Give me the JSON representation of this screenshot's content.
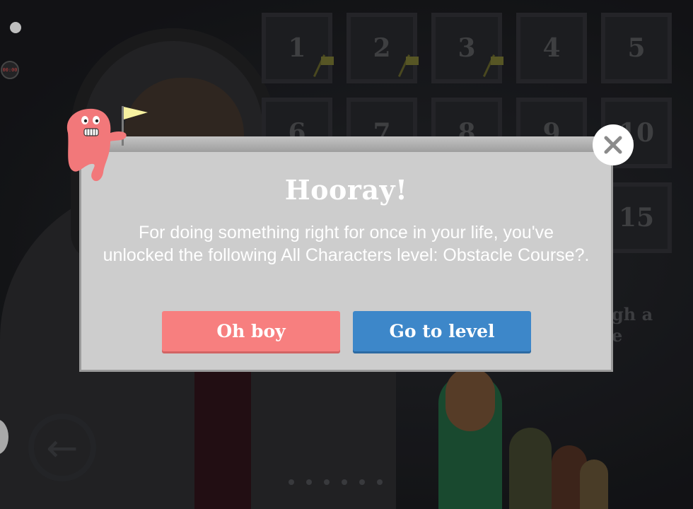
{
  "background": {
    "level_numbers": [
      "1",
      "2",
      "3",
      "4",
      "5",
      "6",
      "7",
      "8",
      "9",
      "10",
      "15"
    ],
    "side_text_line1": "gh a",
    "side_text_line2": "e",
    "timer": "00:00",
    "back_icon": "arrow-left-icon"
  },
  "dialog": {
    "title": "Hooray!",
    "message": "For doing something right for once in your life, you've unlocked the following All Characters level: Obstacle Course?.",
    "oh_boy_label": "Oh boy",
    "go_to_level_label": "Go to level",
    "close_icon": "close-icon"
  },
  "colors": {
    "oh_boy": "#f77f7f",
    "go_to_level": "#3d87c9",
    "dialog_bg": "#cdcdcd",
    "mascot": "#f2787a"
  }
}
